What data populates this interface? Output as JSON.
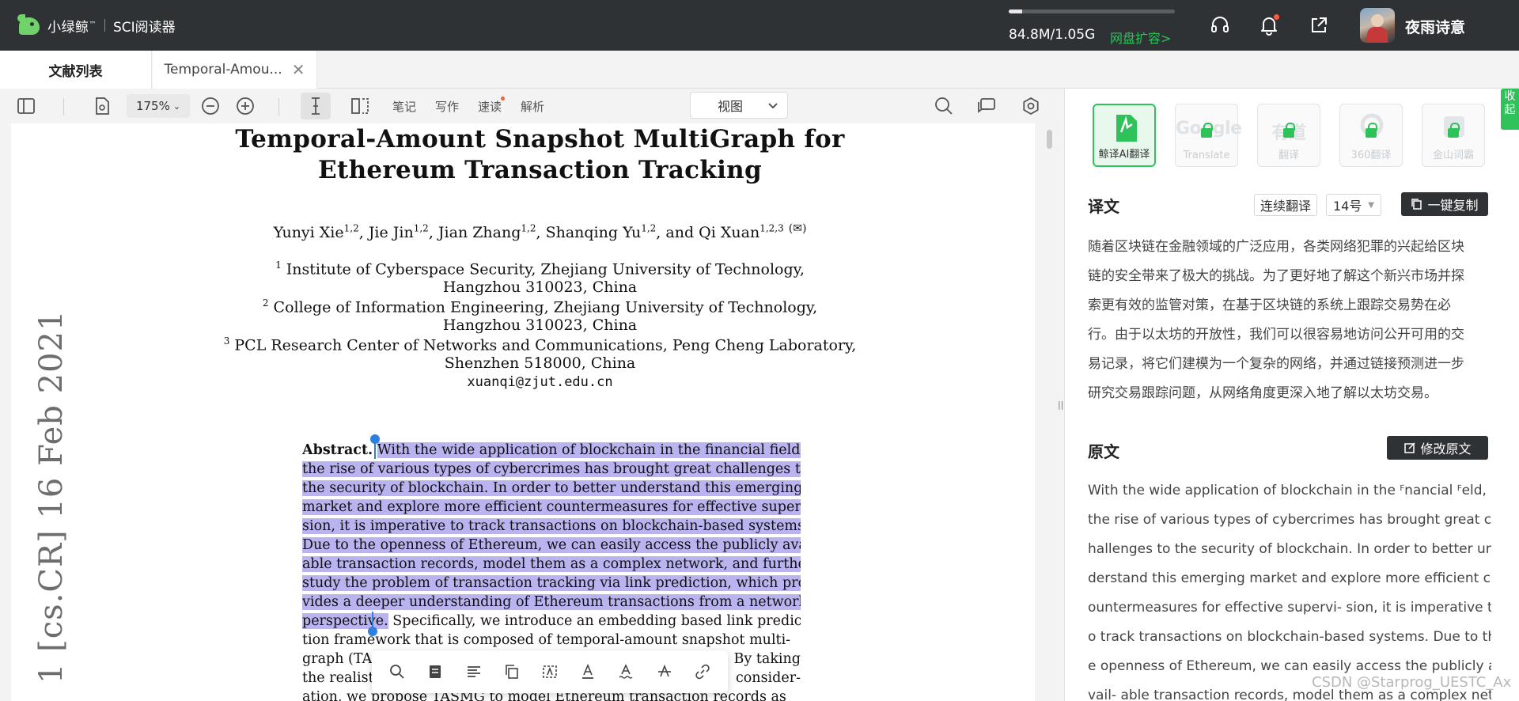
{
  "app": {
    "brand": "小绿鲸",
    "brand_tm": "™",
    "product": "SCI阅读器",
    "storage_fraction": 0.08,
    "storage_text": "84.8M/1.05G",
    "storage_link": "网盘扩容>",
    "username": "夜雨诗意",
    "accent": "#2fc25b"
  },
  "tabs": [
    {
      "label": "文献列表"
    },
    {
      "label": "Temporal-Amou..."
    }
  ],
  "toolbar": {
    "zoom": "175%",
    "note": "笔记",
    "write": "写作",
    "speed_read": "速读",
    "analyze": "解析",
    "view": "视图"
  },
  "paper": {
    "title_line1": "Temporal-Amount Snapshot MultiGraph for",
    "title_line2": "Ethereum Transaction Tracking",
    "authors": [
      {
        "name": "Yunyi Xie",
        "sup": "1,2",
        "sep": ", "
      },
      {
        "name": "Jie Jin",
        "sup": "1,2",
        "sep": ", "
      },
      {
        "name": "Jian Zhang",
        "sup": "1,2",
        "sep": ", "
      },
      {
        "name": "Shanqing Yu",
        "sup": "1,2",
        "sep": ", and "
      },
      {
        "name": "Qi Xuan",
        "sup": "1,2,3",
        "sep": ""
      }
    ],
    "affil": [
      {
        "sup": "1",
        "line1": " Institute of Cyberspace Security, Zhejiang University of Technology,",
        "line2": "Hangzhou 310023, China"
      },
      {
        "sup": "2",
        "line1": " College of Information Engineering, Zhejiang University of Technology,",
        "line2": "Hangzhou 310023, China"
      },
      {
        "sup": "3",
        "line1": " PCL Research Center of Networks and Communications, Peng Cheng Laboratory,",
        "line2": "Shenzhen 518000, China"
      }
    ],
    "email": "xuanqi@zjut.edu.cn",
    "arxiv": "1  [cs.CR]  16 Feb 2021",
    "abstract_label": "Abstract.",
    "abstract_lines": [
      "With the wide application of blockchain in the financial field,",
      "the rise of various types of cybercrimes has brought great challenges to",
      "the security of blockchain. In order to better understand this emerging",
      "market and explore more efficient countermeasures for effective supervi-",
      "sion, it is imperative to track transactions on blockchain-based systems.",
      "Due to the openness of Ethereum, we can easily access the publicly avail-",
      "able transaction records, model them as a complex network, and further",
      "study the problem of transaction tracking via link prediction, which pro-",
      "vides a deeper understanding of Ethereum transactions from a network"
    ],
    "abstract_hl_last": "perspective.",
    "abstract_rest_last": " Specifically, we introduce an embedding based link predic-",
    "abstract_line11": "tion framework that is composed of temporal-amount snapshot multi-",
    "abstract_line12a": "graph (TA",
    "abstract_line12b": "By taking",
    "abstract_line13a": "the realist",
    "abstract_line13b": "consider-",
    "abstract_line14": "ation, we propose TASMG to model Ethereum transaction records as"
  },
  "translate": {
    "engines": [
      {
        "name": "鲸译AI翻译"
      },
      {
        "name": "Google",
        "sub": "Translate"
      },
      {
        "name": "有道",
        "sub": "翻译"
      },
      {
        "name": "360翻译"
      },
      {
        "name": "金山词霸"
      }
    ],
    "collapse": "收起",
    "title": "译文",
    "continuous": "连续翻译",
    "font_size": "14号",
    "copy_all": "一键复制",
    "lines": [
      "随着区块链在金融领域的广泛应用，各类网络犯罪的兴起给区块",
      "链的安全带来了极大的挑战。为了更好地了解这个新兴市场并探",
      "索更有效的监管对策，在基于区块链的系统上跟踪交易势在必",
      "行。由于以太坊的开放性，我们可以很容易地访问公开可用的交",
      "易记录，将它们建模为一个复杂的网络，并通过链接预测进一步",
      "研究交易跟踪问题，从网络角度更深入地了解以太坊交易。"
    ],
    "orig_title": "原文",
    "edit_orig": "修改原文",
    "orig_lines": [
      "With the wide application of blockchain in the ꟳnancial ꟳeld,",
      "the rise of various types of cybercrimes has brought great c",
      "hallenges to the security of blockchain. In order to better un",
      "derstand this emerging market and explore more efficient c",
      "ountermeasures for effective supervi- sion, it is imperative t",
      "o track transactions on blockchain-based systems. Due to th",
      "e openness of Ethereum, we can easily access the publicly a",
      "vail- able transaction records, model them as a complex net"
    ]
  },
  "watermark": "CSDN @Starprog_UESTC_Ax"
}
